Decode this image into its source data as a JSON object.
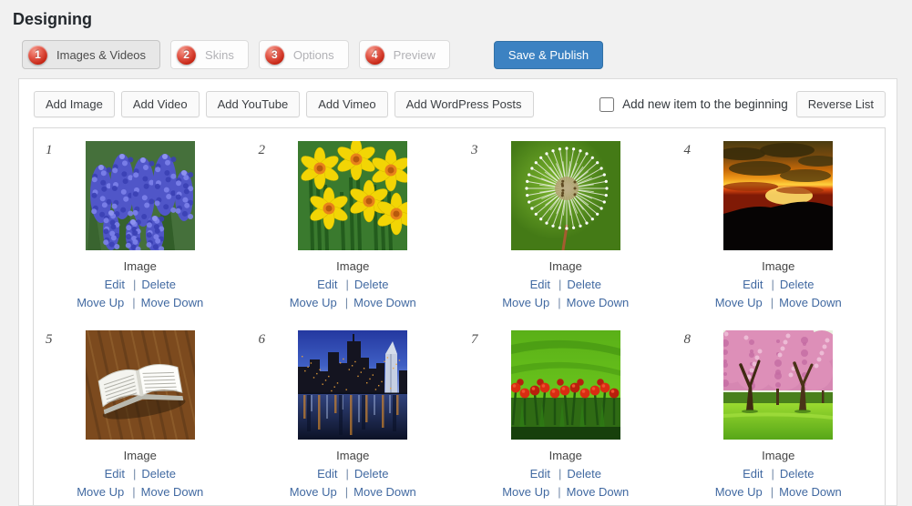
{
  "page": {
    "title": "Designing"
  },
  "tabs": [
    {
      "number": "1",
      "label": "Images & Videos",
      "active": true
    },
    {
      "number": "2",
      "label": "Skins",
      "active": false
    },
    {
      "number": "3",
      "label": "Options",
      "active": false
    },
    {
      "number": "4",
      "label": "Preview",
      "active": false
    }
  ],
  "save_button": "Save & Publish",
  "toolbar": {
    "buttons": [
      "Add Image",
      "Add Video",
      "Add YouTube",
      "Add Vimeo",
      "Add WordPress Posts"
    ],
    "checkbox_label": "Add new item to the beginning",
    "checkbox_checked": false,
    "reverse_button": "Reverse List"
  },
  "item_labels": {
    "type": "Image",
    "edit": "Edit",
    "delete": "Delete",
    "move_up": "Move Up",
    "move_down": "Move Down",
    "separator": "|"
  },
  "items": [
    {
      "number": "1",
      "thumbnail": "grape-hyacinth"
    },
    {
      "number": "2",
      "thumbnail": "daffodils"
    },
    {
      "number": "3",
      "thumbnail": "dandelion"
    },
    {
      "number": "4",
      "thumbnail": "sunset"
    },
    {
      "number": "5",
      "thumbnail": "open-book"
    },
    {
      "number": "6",
      "thumbnail": "city-skyline"
    },
    {
      "number": "7",
      "thumbnail": "tulips"
    },
    {
      "number": "8",
      "thumbnail": "cherry-blossoms"
    }
  ],
  "colors": {
    "accent_blue": "#3c82c2",
    "link_blue": "#4169a1",
    "badge_red": "#c2200f",
    "panel_border": "#dcdcdc"
  }
}
